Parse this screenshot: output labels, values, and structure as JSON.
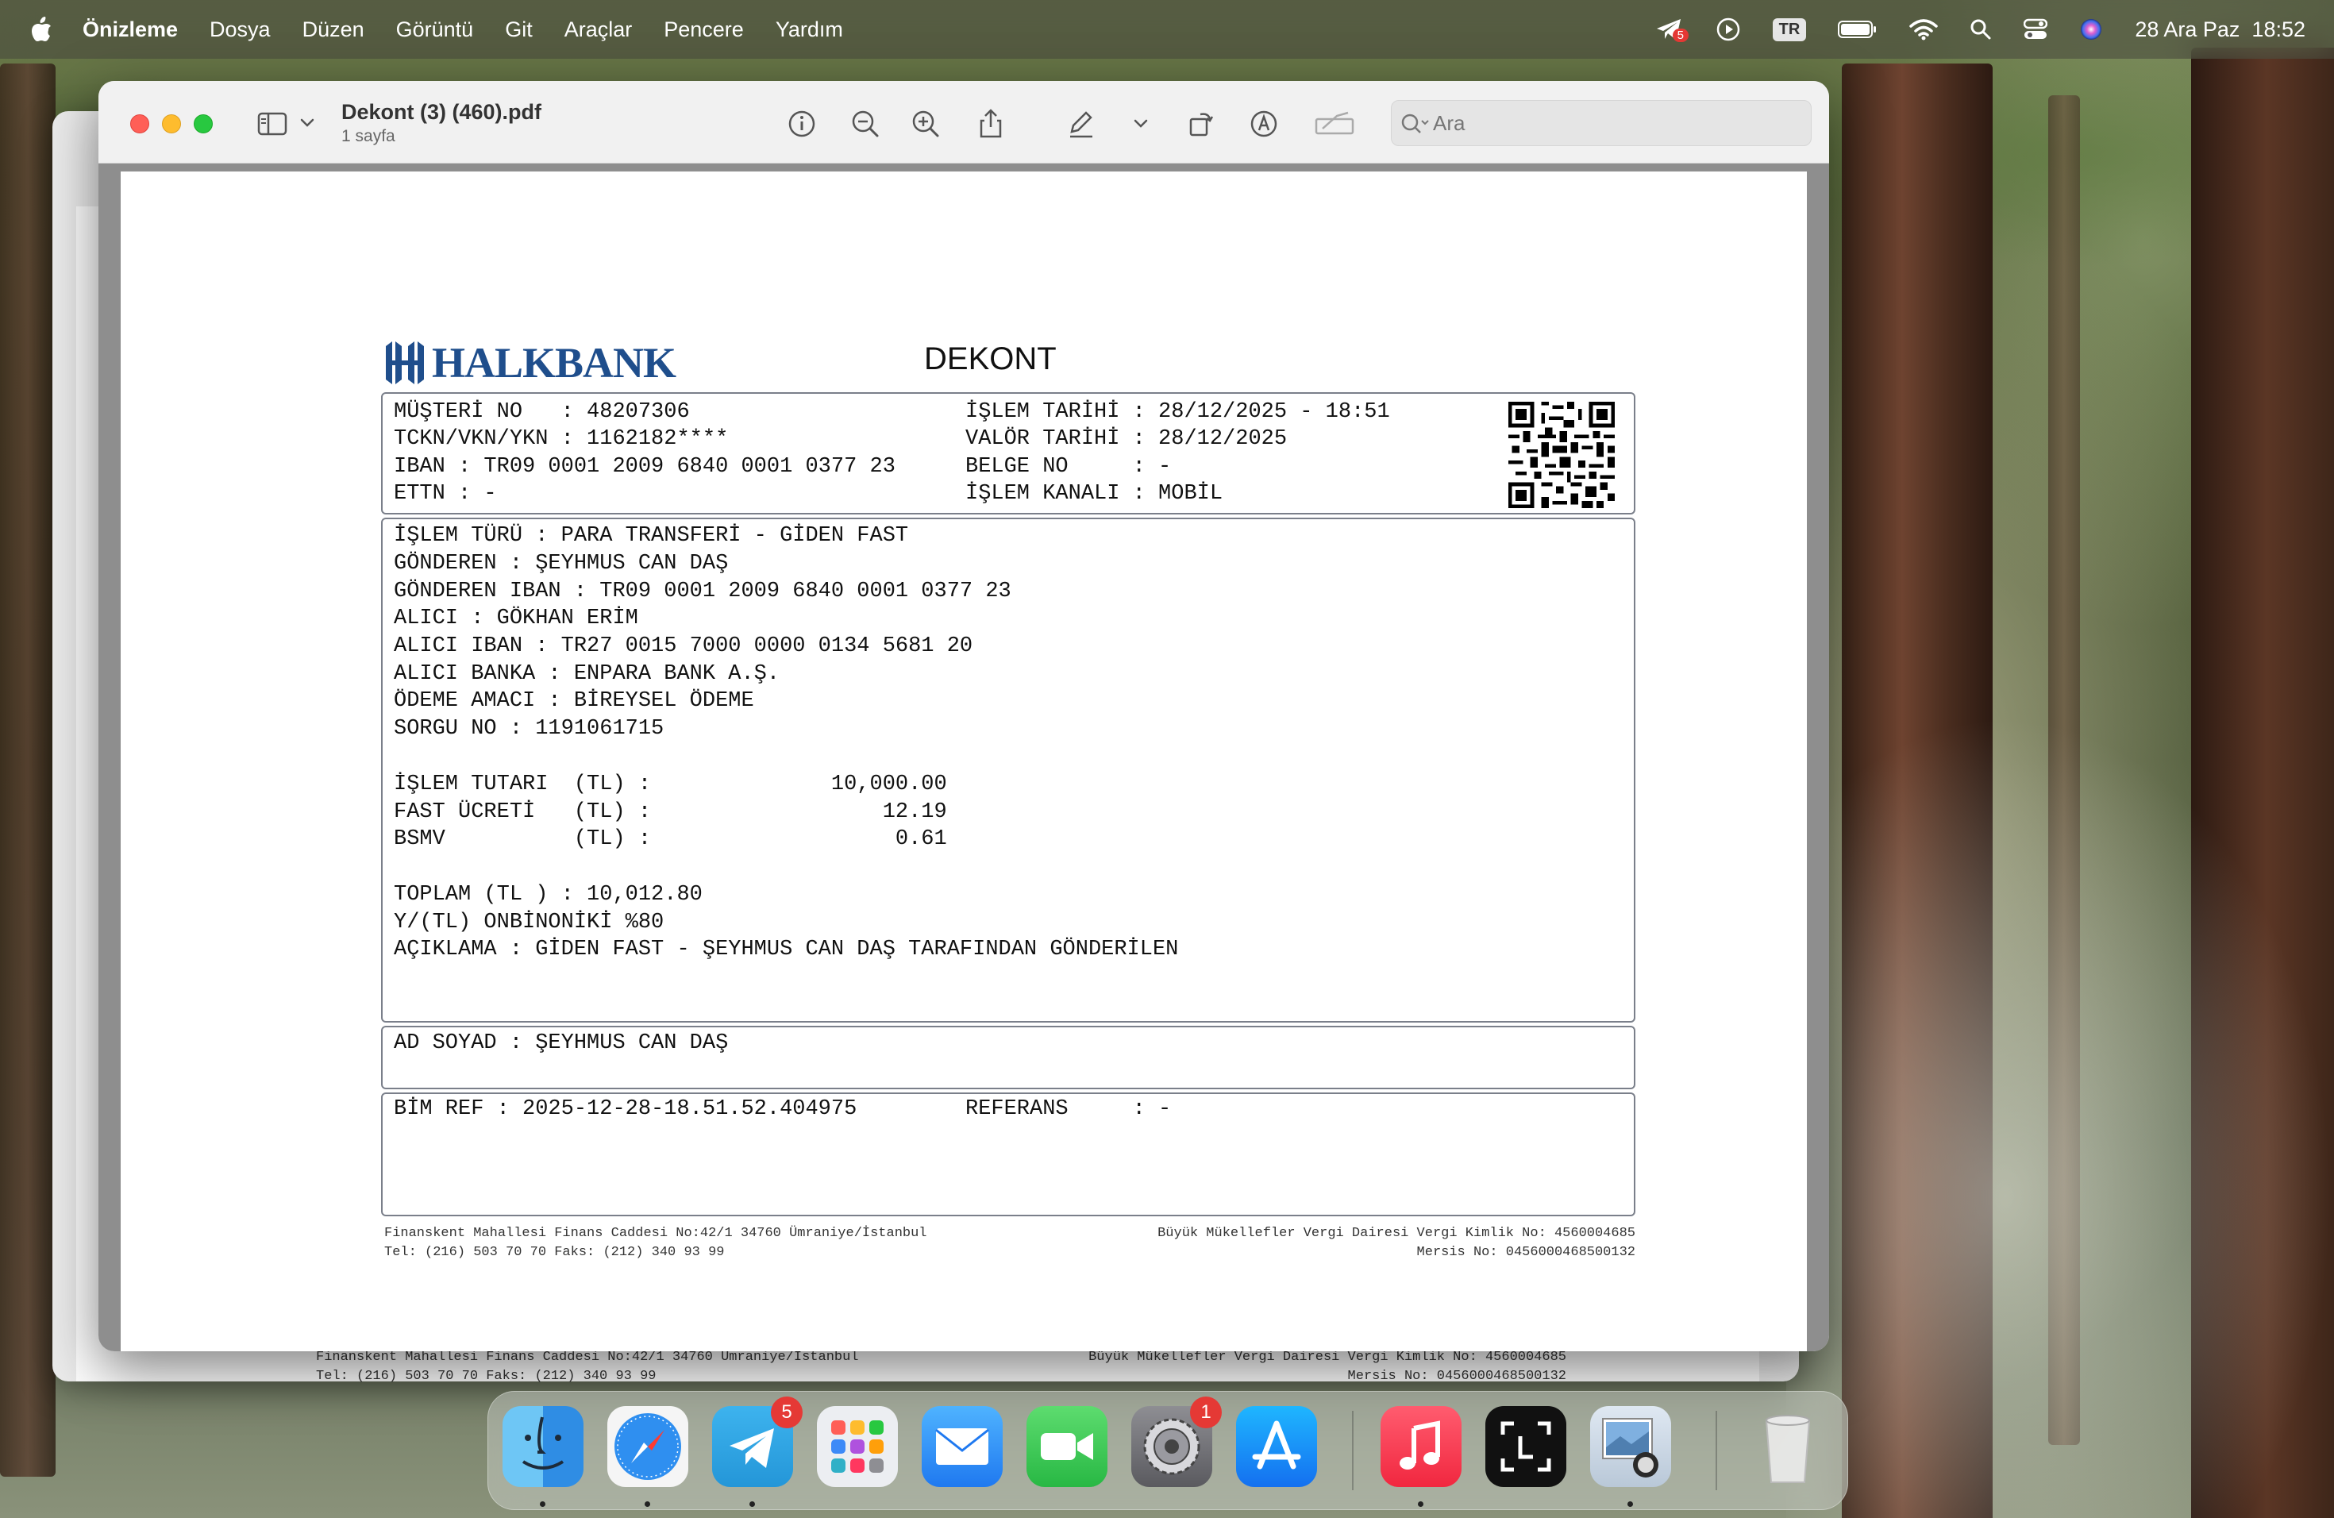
{
  "menubar": {
    "app_name": "Önizleme",
    "items": [
      "Dosya",
      "Düzen",
      "Görüntü",
      "Git",
      "Araçlar",
      "Pencere",
      "Yardım"
    ],
    "notification_badge": "5",
    "input_language": "TR",
    "datetime": "28 Ara Paz  18:52"
  },
  "window": {
    "title": "Dekont (3) (460).pdf",
    "subtitle": "1 sayfa",
    "search_placeholder": "Ara"
  },
  "receipt": {
    "bank_name": "HALKBANK",
    "title": "DEKONT",
    "header_lines": {
      "musteri_no": "MÜŞTERİ NO   : 48207306",
      "tckn": "TCKN/VKN/YKN : 1162182****",
      "iban": "IBAN : TR09 0001 2009 6840 0001 0377 23",
      "ettn": "ETTN : -",
      "islem_tarihi": "İŞLEM TARİHİ : 28/12/2025 - 18:51",
      "valor_tarihi": "VALÖR TARİHİ : 28/12/2025",
      "belge_no": "BELGE NO     : -",
      "islem_kanali": "İŞLEM KANALI : MOBİL"
    },
    "detail_lines": [
      "İŞLEM TÜRÜ : PARA TRANSFERİ - GİDEN FAST",
      "GÖNDEREN : ŞEYHMUS CAN DAŞ",
      "GÖNDEREN IBAN : TR09 0001 2009 6840 0001 0377 23",
      "ALICI : GÖKHAN ERİM",
      "ALICI IBAN : TR27 0015 7000 0000 0134 5681 20",
      "ALICI BANKA : ENPARA BANK A.Ş.",
      "ÖDEME AMACI : BİREYSEL ÖDEME",
      "SORGU NO : 1191061715"
    ],
    "amount_lines": [
      "İŞLEM TUTARI  (TL) :              10,000.00",
      "FAST ÜCRETİ   (TL) :                  12.19",
      "BSMV          (TL) :                   0.61"
    ],
    "total_lines": [
      "TOPLAM (TL ) : 10,012.80",
      "Y/(TL) ONBİNONİKİ %80",
      "AÇIKLAMA : GİDEN FAST - ŞEYHMUS CAN DAŞ TARAFINDAN GÖNDERİLEN"
    ],
    "ad_soyad": "AD SOYAD : ŞEYHMUS CAN DAŞ",
    "bim_ref": "BİM REF : 2025-12-28-18.51.52.404975",
    "referans": "REFERANS     : -",
    "footer_left_1": "Finanskent Mahallesi Finans Caddesi No:42/1 34760 Ümraniye/İstanbul",
    "footer_left_2": "Tel: (216) 503 70 70 Faks: (212) 340 93 99",
    "footer_right_1": "Büyük Mükellefler Vergi Dairesi Vergi Kimlik No: 4560004685",
    "footer_right_2": "Mersis No: 0456000468500132"
  },
  "background_window_footer": {
    "left_1": "Finanskent Mahallesi Finans Caddesi No:42/1 34760 Ümraniye/İstanbul",
    "left_2": "Tel: (216) 503 70 70 Faks: (212) 340 93 99",
    "right_1": "Büyük Mükellefler Vergi Dairesi Vergi Kimlik No: 4560004685",
    "right_2": "Mersis No: 0456000468500132"
  },
  "dock": {
    "apps": [
      {
        "name": "finder-icon",
        "running": true
      },
      {
        "name": "safari-icon",
        "running": true
      },
      {
        "name": "telegram-icon",
        "running": true,
        "badge": "5"
      },
      {
        "name": "launchpad-icon",
        "running": false
      },
      {
        "name": "mail-icon",
        "running": false
      },
      {
        "name": "facetime-icon",
        "running": false
      },
      {
        "name": "system-settings-icon",
        "running": false,
        "badge": "1"
      },
      {
        "name": "app-store-icon",
        "running": false
      },
      {
        "name": "music-icon",
        "running": true
      },
      {
        "name": "screenshot-icon",
        "running": false
      },
      {
        "name": "preview-icon",
        "running": true
      },
      {
        "name": "trash-icon",
        "running": false
      }
    ]
  },
  "colors": {
    "halkbank_blue": "#1f4e8c",
    "close": "#ff5f57",
    "minimize": "#febc2e",
    "zoom": "#28c840",
    "badge_red": "#e53935"
  }
}
